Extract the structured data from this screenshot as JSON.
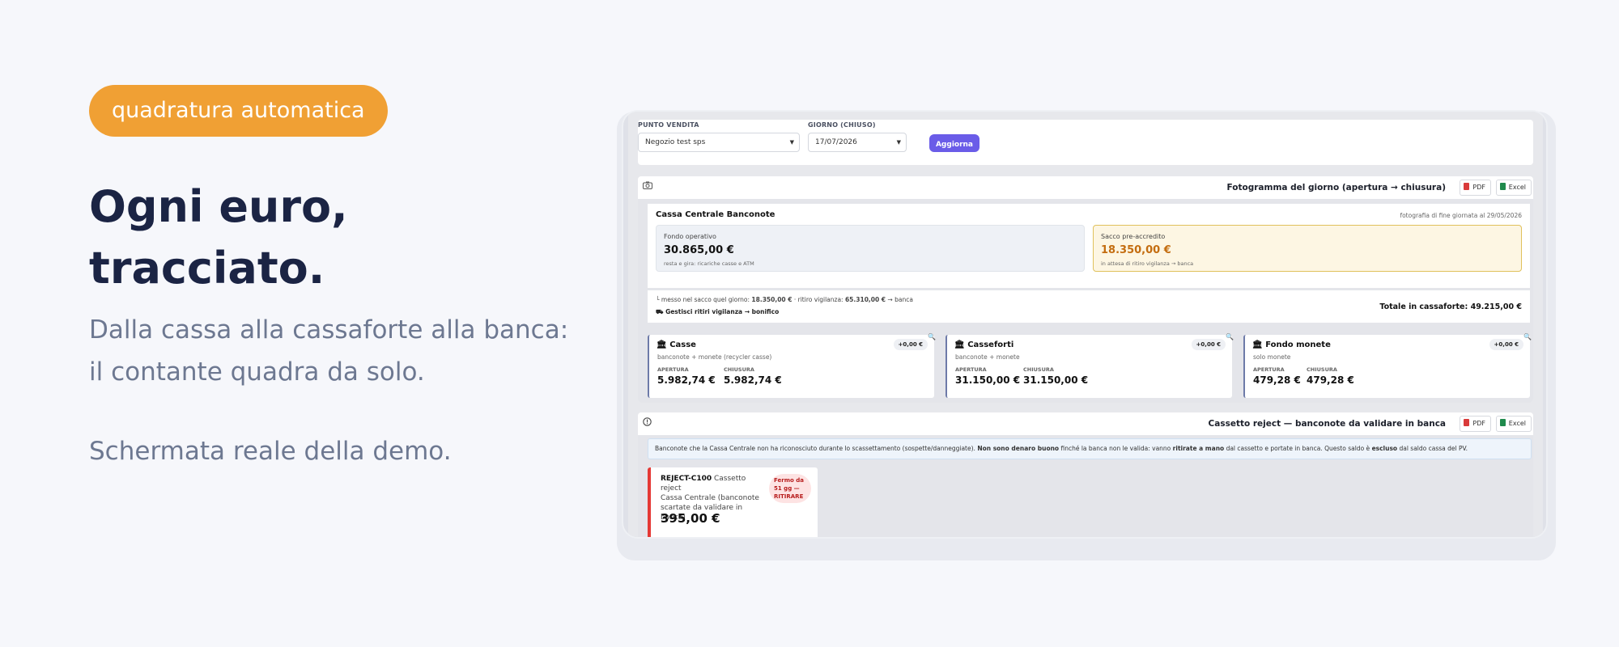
{
  "hero": {
    "badge": "quadratura automatica",
    "headline_1": "Ogni euro,",
    "headline_2": "tracciato.",
    "subline_1": "Dalla cassa alla cassaforte alla banca:",
    "subline_2": "il contante quadra da solo.",
    "note": "Schermata reale della demo."
  },
  "filters": {
    "store_label": "PUNTO VENDITA",
    "store_value": "Negozio test sps",
    "day_label": "GIORNO (CHIUSO)",
    "day_value": "17/07/2026",
    "refresh_button": "Aggiorna"
  },
  "snapshot": {
    "title": "Fotogramma del giorno (apertura → chiusura)",
    "pdf_label": "PDF",
    "excel_label": "Excel",
    "central_title": "Cassa Centrale Banconote",
    "photo_note": "fotografia di fine giornata al 29/05/2026",
    "fondo_label": "Fondo operativo",
    "fondo_amount": "30.865,00 €",
    "fondo_sub": "resta e gira: ricariche casse e ATM",
    "sacco_label": "Sacco pre-accredito",
    "sacco_amount": "18.350,00 €",
    "sacco_sub": "in attesa di ritiro vigilanza → banca",
    "flow_prefix": "└ messo nel sacco quel giorno:",
    "flow_sacco": "18.350,00 €",
    "flow_mid": "· ritiro vigilanza:",
    "flow_ritiro": "65.310,00 €",
    "flow_suffix": "→ banca",
    "manage_link": "Gestisci ritiri vigilanza → bonifico",
    "total_label": "Totale in cassaforte: 49.215,00 €",
    "cards": [
      {
        "title": "Casse",
        "sub": "banconote + monete (recycler casse)",
        "delta": "+0,00 €",
        "open_label": "APERTURA",
        "close_label": "CHIUSURA",
        "open": "5.982,74 €",
        "close": "5.982,74 €"
      },
      {
        "title": "Casseforti",
        "sub": "banconote + monete",
        "delta": "+0,00 €",
        "open_label": "APERTURA",
        "close_label": "CHIUSURA",
        "open": "31.150,00 €",
        "close": "31.150,00 €"
      },
      {
        "title": "Fondo monete",
        "sub": "solo monete",
        "delta": "+0,00 €",
        "open_label": "APERTURA",
        "close_label": "CHIUSURA",
        "open": "479,28 €",
        "close": "479,28 €"
      }
    ]
  },
  "reject": {
    "title": "Cassetto reject — banconote da validare in banca",
    "pdf_label": "PDF",
    "excel_label": "Excel",
    "info_1": "Banconote che la Cassa Centrale non ha riconosciuto durante lo scassettamento (sospette/danneggiate).",
    "info_bold_1": "Non sono denaro buono",
    "info_2": "finché la banca non le valida: vanno",
    "info_bold_2": "ritirate a mano",
    "info_3": "dal cassetto e portate in banca. Questo saldo è",
    "info_bold_3": "escluso",
    "info_4": "dal saldo cassa del PV.",
    "card_code": "REJECT-C100",
    "card_desc_1": "Cassetto reject",
    "card_desc_2": "Cassa Centrale (banconote",
    "card_desc_3": "scartate da validare in banca)",
    "status_1": "Fermo da",
    "status_2": "51 gg —",
    "status_3": "RITIRARE",
    "card_amount": "395,00 €"
  },
  "colors": {
    "badge": "#f0a034",
    "headline": "#1b2444",
    "muted": "#6d7891",
    "primary_button": "#6a5ce8",
    "sacco_amount": "#c46d10",
    "reject_border": "#e53935"
  }
}
